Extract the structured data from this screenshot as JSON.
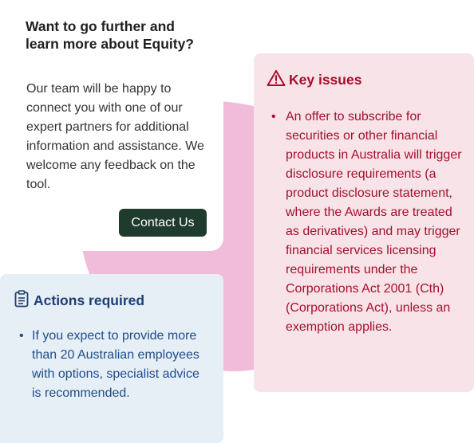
{
  "info": {
    "title": "Want to go further and learn more about Equity?",
    "body": "Our team will be happy to connect you with one of our expert partners for additional information and assistance. We welcome any feedback on the tool.",
    "contact_label": "Contact Us"
  },
  "key_issues": {
    "title": "Key issues",
    "icon": "warning-triangle-icon",
    "items": [
      "An offer to subscribe for securities or other financial products in Australia will trigger disclosure requirements (a product disclosure statement, where the Awards are treated as derivatives) and may trigger financial services licensing requirements under the Corporations Act 2001 (Cth) (Corporations Act), unless an exemption applies."
    ]
  },
  "actions": {
    "title": "Actions required",
    "icon": "clipboard-icon",
    "items": [
      "If you expect to provide more than 20 Australian employees with options, specialist advice is recommended."
    ]
  },
  "colors": {
    "key_issues_text": "#a50f2d",
    "key_issues_bg": "#f8e4e8",
    "actions_text": "#1d3f73",
    "actions_bg": "#e6eef6",
    "button_bg": "#1f3b2e",
    "blob": "#f0bcd9"
  }
}
